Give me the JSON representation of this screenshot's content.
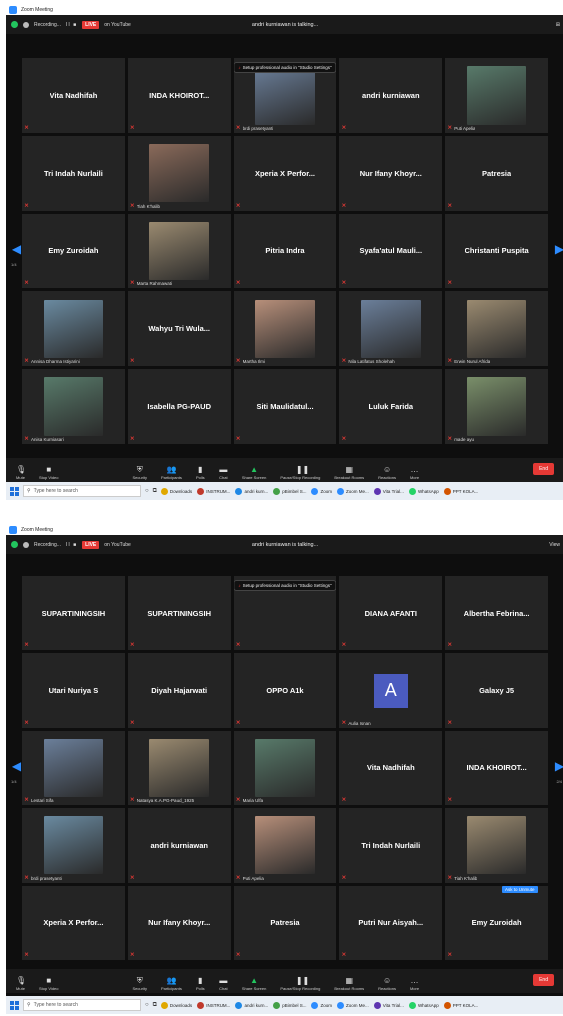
{
  "window_title": "Zoom Meeting",
  "recording_label": "Recording...",
  "recording_label_2": "Recording...",
  "pause_stop": "II ■",
  "live_badge": "LIVE",
  "youtube_label": "on YouTube",
  "talking_label": "andri kurniawan is talking...",
  "view_label": "View",
  "banner_text": "Setup professional audio in \"Studio Settings\"",
  "banner_name_under": "fadjar_imam_fadjar",
  "page_left_1": "1/4",
  "page_right_1": "2/4",
  "page_left_2": "1/4",
  "page_right_2": "2/4",
  "toolbar": {
    "mute": "Mute",
    "stop_video": "Stop Video",
    "security": "Security",
    "participants": "Participants",
    "participants_count": "47",
    "polls": "Polls",
    "chat": "Chat",
    "share_screen": "Share Screen",
    "pause_stop_recording": "Pause/Stop Recording",
    "breakout_rooms": "Breakout Rooms",
    "reactions": "Reactions",
    "more": "More",
    "end": "End"
  },
  "taskbar": {
    "search_placeholder": "Type here to search",
    "apps_1": [
      "Downloads",
      "INSTRUM...",
      "andri kurn...",
      "pBimbel S...",
      "Zoom",
      "Zoom Me...",
      "Vita Trial...",
      "WhatsApp",
      "PPT KOLA..."
    ],
    "apps_2": [
      "Downloads",
      "INSTRUM...",
      "andri kurn...",
      "pBimbel S...",
      "Zoom",
      "Zoom Me...",
      "Vita Trial...",
      "WhatsApp",
      "PPT KOLA..."
    ]
  },
  "screen1": {
    "tiles": [
      {
        "big": "Vita Nadhifah",
        "small": ""
      },
      {
        "big": "INDA KHOIROT...",
        "small": ""
      },
      {
        "big": "",
        "small": "brdi prasetyanti",
        "photo": true
      },
      {
        "big": "andri kurniawan",
        "small": ""
      },
      {
        "big": "",
        "small": "Puti Apelia",
        "photo": true
      },
      {
        "big": "Tri Indah Nurlaili",
        "small": ""
      },
      {
        "big": "",
        "small": "Tiah K'halib",
        "photo": true
      },
      {
        "big": "Xperia X Perfor...",
        "small": ""
      },
      {
        "big": "Nur Ifany Khoyr...",
        "small": ""
      },
      {
        "big": "Patresia",
        "small": ""
      },
      {
        "big": "Emy Zuroidah",
        "small": ""
      },
      {
        "big": "",
        "small": "Marta Rahmawati",
        "photo": true
      },
      {
        "big": "Pitria Indra",
        "small": ""
      },
      {
        "big": "Syafa'atul Mauli...",
        "small": ""
      },
      {
        "big": "Christanti Puspita",
        "small": ""
      },
      {
        "big": "",
        "small": "Annisa Dharma Istiyarini",
        "photo": true
      },
      {
        "big": "Wahyu Tri Wula...",
        "small": ""
      },
      {
        "big": "",
        "small": "Martha Ilmi",
        "photo": true
      },
      {
        "big": "",
        "small": "Nila Latifatus Sholehah",
        "photo": true
      },
      {
        "big": "",
        "small": "Erwin Nurul Afrida",
        "photo": true
      },
      {
        "big": "",
        "small": "Anisa Kurniasari",
        "photo": true
      },
      {
        "big": "Isabella PG-PAUD",
        "small": ""
      },
      {
        "big": "Siti Maulidatul...",
        "small": ""
      },
      {
        "big": "Luluk Farida",
        "small": ""
      },
      {
        "big": "",
        "small": "made ayu",
        "photo": true
      }
    ]
  },
  "screen2": {
    "tiles": [
      {
        "big": "SUPARTININGSIH",
        "small": ""
      },
      {
        "big": "SUPARTININGSIH",
        "small": ""
      },
      {
        "big": "",
        "small": ""
      },
      {
        "big": "DIANA AFANTI",
        "small": ""
      },
      {
        "big": "Albertha Febrina...",
        "small": ""
      },
      {
        "big": "Utari Nuriya S",
        "small": ""
      },
      {
        "big": "Diyah Hajarwati",
        "small": ""
      },
      {
        "big": "OPPO A1k",
        "small": ""
      },
      {
        "big": "",
        "small": "Aulia Isnan",
        "letter": "A"
      },
      {
        "big": "Galaxy J5",
        "small": ""
      },
      {
        "big": "",
        "small": "Lestari Sifa",
        "photo": true
      },
      {
        "big": "",
        "small": "Natasya K.A.PG-Paud_1925",
        "photo": true
      },
      {
        "big": "",
        "small": "Maria Ulfa",
        "photo": true
      },
      {
        "big": "Vita Nadhifah",
        "small": ""
      },
      {
        "big": "INDA KHOIROT...",
        "small": ""
      },
      {
        "big": "",
        "small": "brdi prasetyanti",
        "photo": true
      },
      {
        "big": "andri kurniawan",
        "small": ""
      },
      {
        "big": "",
        "small": "Puti Apelia",
        "photo": true
      },
      {
        "big": "Tri Indah Nurlaili",
        "small": ""
      },
      {
        "big": "",
        "small": "Tiah K'halib",
        "photo": true
      },
      {
        "big": "Xperia X Perfor...",
        "small": ""
      },
      {
        "big": "Nur Ifany Khoyr...",
        "small": ""
      },
      {
        "big": "Patresia",
        "small": ""
      },
      {
        "big": "Putri Nur Aisyah...",
        "small": ""
      },
      {
        "big": "Emy Zuroidah",
        "small": ""
      }
    ],
    "ask_to_unmute": "Ask to Unmute"
  }
}
